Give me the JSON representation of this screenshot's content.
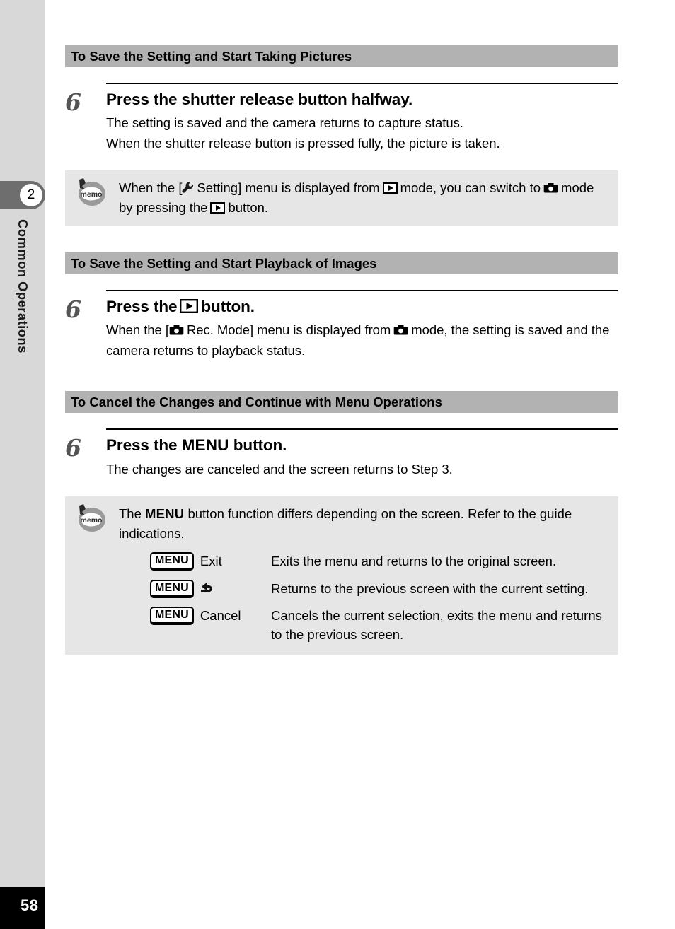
{
  "sidebar": {
    "chapter_number": "2",
    "chapter_title": "Common Operations",
    "page_number": "58"
  },
  "sections": [
    {
      "heading": "To Save the Setting and Start Taking Pictures",
      "step_number": "6",
      "step_title": "Press the shutter release button halfway.",
      "body_line_1": "The setting is saved and the camera returns to capture status.",
      "body_line_2": "When the shutter release button is pressed fully, the picture is taken."
    },
    {
      "heading": "To Save the Setting and Start Playback of Images",
      "step_number": "6",
      "step_title_before": "Press the",
      "step_title_after": "button.",
      "body_part_1": "When the [",
      "body_part_2": "Rec. Mode] menu is displayed from",
      "body_part_3": "mode, the setting is saved and the camera returns to playback status."
    },
    {
      "heading": "To Cancel the Changes and Continue with Menu Operations",
      "step_number": "6",
      "step_title_before": "Press the",
      "step_title_menu": "MENU",
      "step_title_after": "button.",
      "body_line_1": "The changes are canceled and the screen returns to Step 3."
    }
  ],
  "memo_top": {
    "icon_label": "memo",
    "part_1": "When the [",
    "part_2": "Setting] menu is displayed from",
    "part_3": "mode, you can switch to",
    "part_4": "mode by pressing the",
    "part_5": "button."
  },
  "memo_bottom": {
    "icon_label": "memo",
    "intro_part_1": "The",
    "intro_menu": "MENU",
    "intro_part_2": "button function differs depending on the screen. Refer to the guide indications.",
    "rows": [
      {
        "button_label": "MENU",
        "key_label": "Exit",
        "key_icon": "",
        "description": "Exits the menu and returns to the original screen."
      },
      {
        "button_label": "MENU",
        "key_label": "",
        "key_icon": "return-arrow-icon",
        "description": "Returns to the previous screen with the current setting."
      },
      {
        "button_label": "MENU",
        "key_label": "Cancel",
        "key_icon": "",
        "description": "Cancels the current selection, exits the menu and returns to the previous screen."
      }
    ]
  },
  "colors": {
    "section_bar": "#b2b2b2",
    "memo_background": "#e6e6e6",
    "sidebar": "#d8d8d8",
    "chapter_tab": "#6e6e6e",
    "page_block": "#000000"
  }
}
